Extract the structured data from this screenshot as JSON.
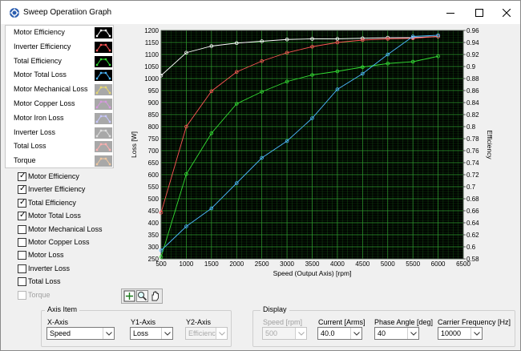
{
  "window": {
    "title": "Sweep Operatiion Graph",
    "buttons": {
      "minimize": "minimize",
      "maximize": "maximize",
      "close": "close"
    }
  },
  "legend": [
    {
      "label": "Motor Efficiency",
      "color": "#ffffff",
      "enabled": true
    },
    {
      "label": "Inverter Efficiency",
      "color": "#ff5555",
      "enabled": true
    },
    {
      "label": "Total Efficiency",
      "color": "#33dd33",
      "enabled": true
    },
    {
      "label": "Motor Total Loss",
      "color": "#4db8ff",
      "enabled": true
    },
    {
      "label": "Motor Mechanical Loss",
      "color": "#e8d870",
      "enabled": false
    },
    {
      "label": "Motor Copper Loss",
      "color": "#d898e0",
      "enabled": false
    },
    {
      "label": "Motor Iron Loss",
      "color": "#c8c8ff",
      "enabled": false
    },
    {
      "label": "Inverter Loss",
      "color": "#e0e0e0",
      "enabled": false
    },
    {
      "label": "Total Loss",
      "color": "#ffb0b0",
      "enabled": false
    },
    {
      "label": "Torque",
      "color": "#f0c8a0",
      "enabled": false
    }
  ],
  "checkboxes": [
    {
      "label": "Motor Efficiency",
      "checked": true,
      "enabled": true
    },
    {
      "label": "Inverter Efficiency",
      "checked": true,
      "enabled": true
    },
    {
      "label": "Total Efficiency",
      "checked": true,
      "enabled": true
    },
    {
      "label": "Motor Total Loss",
      "checked": true,
      "enabled": true
    },
    {
      "label": "Motor Mechanical Loss",
      "checked": false,
      "enabled": true
    },
    {
      "label": "Motor Copper Loss",
      "checked": false,
      "enabled": true
    },
    {
      "label": "Motor Loss",
      "checked": false,
      "enabled": true
    },
    {
      "label": "Inverter Loss",
      "checked": false,
      "enabled": true
    },
    {
      "label": "Total Loss",
      "checked": false,
      "enabled": true
    },
    {
      "label": "Torque",
      "checked": false,
      "enabled": false
    }
  ],
  "chart_data": {
    "type": "line",
    "xlabel": "Speed (Output Axis) [rpm]",
    "ylabel": "Loss [W]",
    "y2label": "Efficiency",
    "xlim": [
      500,
      6500
    ],
    "ylim": [
      250,
      1200
    ],
    "y2lim": [
      0.58,
      0.96
    ],
    "xticks": [
      500,
      1000,
      1500,
      2000,
      2500,
      3000,
      3500,
      4000,
      4500,
      5000,
      5500,
      6000,
      6500
    ],
    "yticks": [
      250,
      300,
      350,
      400,
      450,
      500,
      550,
      600,
      650,
      700,
      750,
      800,
      850,
      900,
      950,
      1000,
      1050,
      1100,
      1150,
      1200
    ],
    "y2ticks": [
      "0.58",
      "0.6",
      "0.62",
      "0.64",
      "0.66",
      "0.68",
      "0.7",
      "0.72",
      "0.74",
      "0.76",
      "0.78",
      "0.8",
      "0.82",
      "0.84",
      "0.86",
      "0.88",
      "0.9",
      "0.92",
      "0.94",
      "0.96"
    ],
    "grid": true,
    "background": "#000000",
    "grid_color": "#1f7a1f",
    "x": [
      500,
      1000,
      1500,
      2000,
      2500,
      3000,
      3500,
      4000,
      4500,
      5000,
      5500,
      6000
    ],
    "series": [
      {
        "name": "Motor Efficiency",
        "axis": "y2",
        "color": "#ffffff",
        "values": [
          0.885,
          0.923,
          0.934,
          0.939,
          0.942,
          0.945,
          0.946,
          0.946,
          0.947,
          0.948,
          0.948,
          0.95
        ]
      },
      {
        "name": "Inverter Efficiency",
        "axis": "y2",
        "color": "#ff5555",
        "values": [
          0.657,
          0.8,
          0.859,
          0.891,
          0.909,
          0.923,
          0.933,
          0.94,
          0.944,
          0.946,
          0.947,
          0.95
        ]
      },
      {
        "name": "Total Efficiency",
        "axis": "y2",
        "color": "#33dd33",
        "values": [
          0.583,
          0.721,
          0.789,
          0.838,
          0.858,
          0.875,
          0.886,
          0.892,
          0.899,
          0.905,
          0.908,
          0.917
        ]
      },
      {
        "name": "Motor Total Loss",
        "axis": "y",
        "color": "#4db8ff",
        "values": [
          285,
          385,
          460,
          565,
          670,
          740,
          835,
          955,
          1020,
          1100,
          1175,
          1180
        ]
      }
    ]
  },
  "toolbar": {
    "icons": [
      "fit-icon",
      "zoom-icon",
      "pan-icon"
    ]
  },
  "axis_item": {
    "title": "Axis Item",
    "x_axis": {
      "label": "X-Axis",
      "value": "Speed"
    },
    "y1_axis": {
      "label": "Y1-Axis",
      "value": "Loss"
    },
    "y2_axis": {
      "label": "Y2-Axis",
      "value": "Efficienc"
    }
  },
  "display": {
    "title": "Display",
    "speed": {
      "label": "Speed [rpm]",
      "value": "500"
    },
    "current": {
      "label": "Current [Arms]",
      "value": "40.0"
    },
    "phase_angle": {
      "label": "Phase Angle [deg]",
      "value": "40"
    },
    "carrier_freq": {
      "label": "Carrier Frequency [Hz]",
      "value": "10000"
    }
  }
}
